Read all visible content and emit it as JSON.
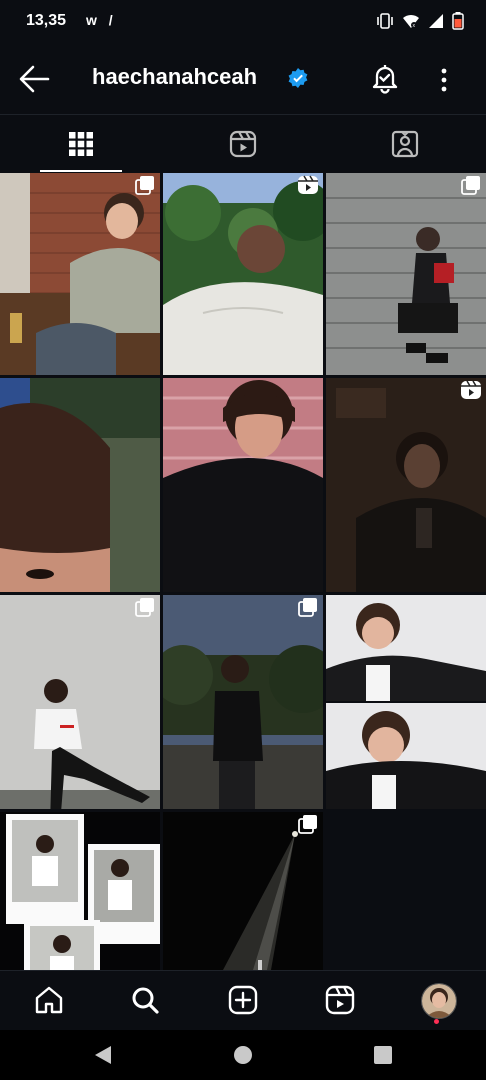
{
  "status_bar": {
    "time": "13,35",
    "left_icons": "w /",
    "icons": [
      "vibrate-icon",
      "wifi-icon",
      "signal-icon",
      "battery-icon"
    ]
  },
  "header": {
    "username": "haechanahceah",
    "verified": true,
    "icons": [
      "back-arrow-icon",
      "verified-badge-icon",
      "notification-bell-icon",
      "more-vertical-icon"
    ],
    "accent_color": "#1d9bf0"
  },
  "tabs": [
    {
      "name": "posts",
      "icon": "grid-icon",
      "active": true
    },
    {
      "name": "reels",
      "icon": "reels-icon",
      "active": false
    },
    {
      "name": "tagged",
      "icon": "tagged-icon",
      "active": false
    }
  ],
  "posts": [
    {
      "kind": "carousel",
      "scene": "brick wall, sitting on bench in grey sweatshirt"
    },
    {
      "kind": "reel",
      "scene": "back view, white shirt, trees"
    },
    {
      "kind": "carousel",
      "scene": "crouching on stone steps"
    },
    {
      "kind": "photo",
      "scene": "close-up selfie, forehead and eye"
    },
    {
      "kind": "photo",
      "scene": "portrait, black t-shirt, pink wall"
    },
    {
      "kind": "reel",
      "scene": "dark room, black hoodie"
    },
    {
      "kind": "carousel",
      "scene": "white t-shirt, kicking pose, grey wall"
    },
    {
      "kind": "carousel",
      "scene": "black t-shirt, evening street"
    },
    {
      "kind": "photo",
      "scene": "two-panel, black jacket, white background"
    },
    {
      "kind": "photo",
      "scene": "polaroid collage on black"
    },
    {
      "kind": "carousel",
      "scene": "dark, spotlight beam"
    },
    {
      "kind": "empty",
      "scene": ""
    }
  ],
  "bottom_nav": [
    {
      "name": "home",
      "icon": "home-icon"
    },
    {
      "name": "search",
      "icon": "search-icon"
    },
    {
      "name": "create",
      "icon": "add-post-icon"
    },
    {
      "name": "reels",
      "icon": "reels-icon"
    },
    {
      "name": "profile",
      "icon": "profile-avatar",
      "notification_dot": true
    }
  ],
  "system_nav": [
    "back-triangle-icon",
    "home-circle-icon",
    "recents-square-icon"
  ],
  "colors": {
    "background": "#0b0d12",
    "notification_dot": "#ff2f55"
  }
}
